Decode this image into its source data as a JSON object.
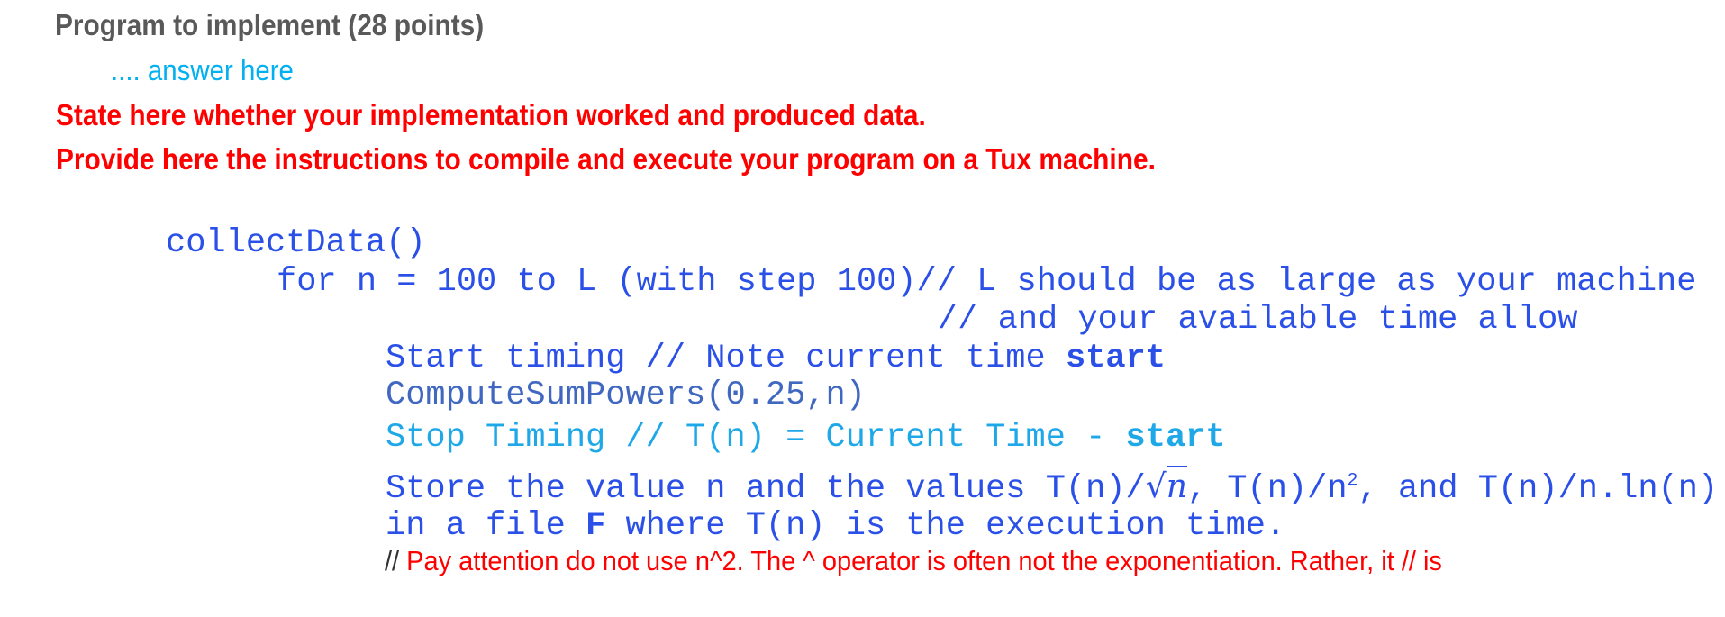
{
  "heading": {
    "title": "Program to implement (28 points)",
    "answer_placeholder": ".... answer here",
    "instruction_1": "State here whether your implementation worked and produced data.",
    "instruction_2": "Provide here the instructions to compile and execute your program on a Tux machine."
  },
  "colors": {
    "title": "#595959",
    "answer": "#00b0f0",
    "instruction": "#ff0000",
    "code_blue": "#2a50e8",
    "code_steel": "#4068c0",
    "code_light": "#1ea8e8"
  },
  "pseudocode": {
    "line1": "collectData()",
    "line2": "for n = 100 to L (with step 100)// L should be as large as your machine",
    "line3": "// and your available time allow",
    "line4_text": "Start timing // Note current time ",
    "line4_bold": "start",
    "line5": "ComputeSumPowers(0.25,n)",
    "line6_text": "Stop Timing // T(n) = Current Time - ",
    "line6_bold": "start",
    "line7_a": "Store the value n and the values T(n)/",
    "line7_sqrt": "√",
    "line7_n": "n",
    "line7_b": ", T(n)/n",
    "line7_sup": "2",
    "line7_c": ", and T(n)/n.ln(n)",
    "line8_a": "in a file ",
    "line8_bold": "F",
    "line8_b": " where T(n) is the execution time.",
    "note_slashes": "//",
    "note_text": " Pay attention do not use n^2. The ^ operator is often not the exponentiation. Rather, it // is"
  }
}
